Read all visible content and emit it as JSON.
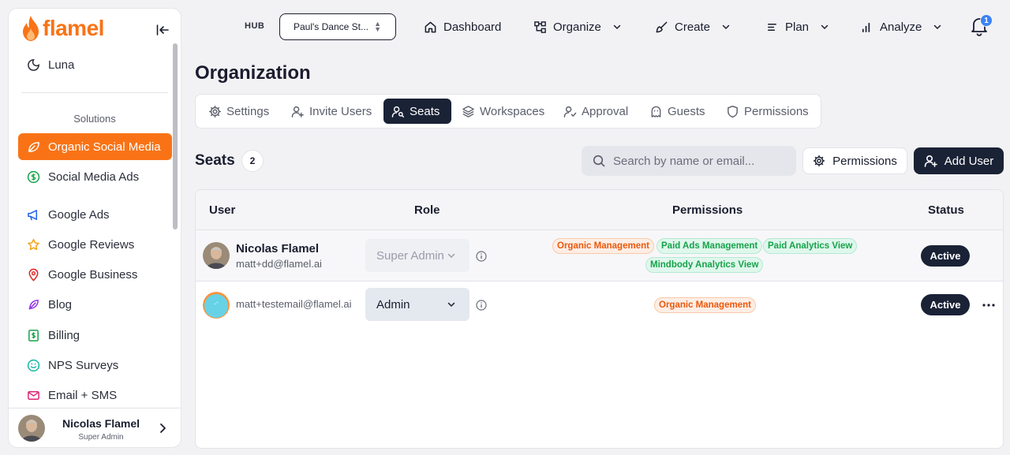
{
  "brand": {
    "name": "flamel",
    "color": "#f97316"
  },
  "sidebar": {
    "luna_label": "Luna",
    "section_label": "Solutions",
    "items": [
      {
        "label": "Organic Social Media",
        "icon": "leaf-icon",
        "active": true
      },
      {
        "label": "Social Media Ads",
        "icon": "dollar-circle-icon"
      },
      {
        "label": "Google Ads",
        "icon": "megaphone-icon"
      },
      {
        "label": "Google Reviews",
        "icon": "star-icon"
      },
      {
        "label": "Google Business",
        "icon": "map-pin-icon"
      },
      {
        "label": "Blog",
        "icon": "feather-icon"
      },
      {
        "label": "Billing",
        "icon": "billing-icon"
      },
      {
        "label": "NPS Surveys",
        "icon": "smile-icon"
      },
      {
        "label": "Email + SMS",
        "icon": "mail-icon"
      }
    ],
    "profile": {
      "name": "Nicolas Flamel",
      "role": "Super Admin"
    }
  },
  "topbar": {
    "hub_label": "HUB",
    "hub_value": "Paul's Dance St...",
    "nav": {
      "dashboard": "Dashboard",
      "organize": "Organize",
      "create": "Create",
      "plan": "Plan",
      "analyze": "Analyze"
    },
    "notifications_count": "1"
  },
  "page": {
    "title": "Organization",
    "tabs": {
      "settings": "Settings",
      "invite_users": "Invite Users",
      "seats": "Seats",
      "workspaces": "Workspaces",
      "approval": "Approval",
      "guests": "Guests",
      "permissions": "Permissions"
    },
    "active_tab": "Seats"
  },
  "seats": {
    "title": "Seats",
    "count": "2",
    "search_placeholder": "Search by name or email...",
    "permissions_button": "Permissions",
    "add_user_button": "Add User",
    "columns": {
      "user": "User",
      "role": "Role",
      "permissions": "Permissions",
      "status": "Status"
    },
    "rows": [
      {
        "name": "Nicolas Flamel",
        "email": "matt+dd@flamel.ai",
        "role": "Super Admin",
        "permissions": [
          "Organic Management",
          "Paid Ads Management",
          "Paid Analytics View",
          "Mindbody Analytics View"
        ],
        "status": "Active"
      },
      {
        "name": "",
        "email": "matt+testemail@flamel.ai",
        "role": "Admin",
        "permissions": [
          "Organic Management"
        ],
        "status": "Active"
      }
    ]
  }
}
